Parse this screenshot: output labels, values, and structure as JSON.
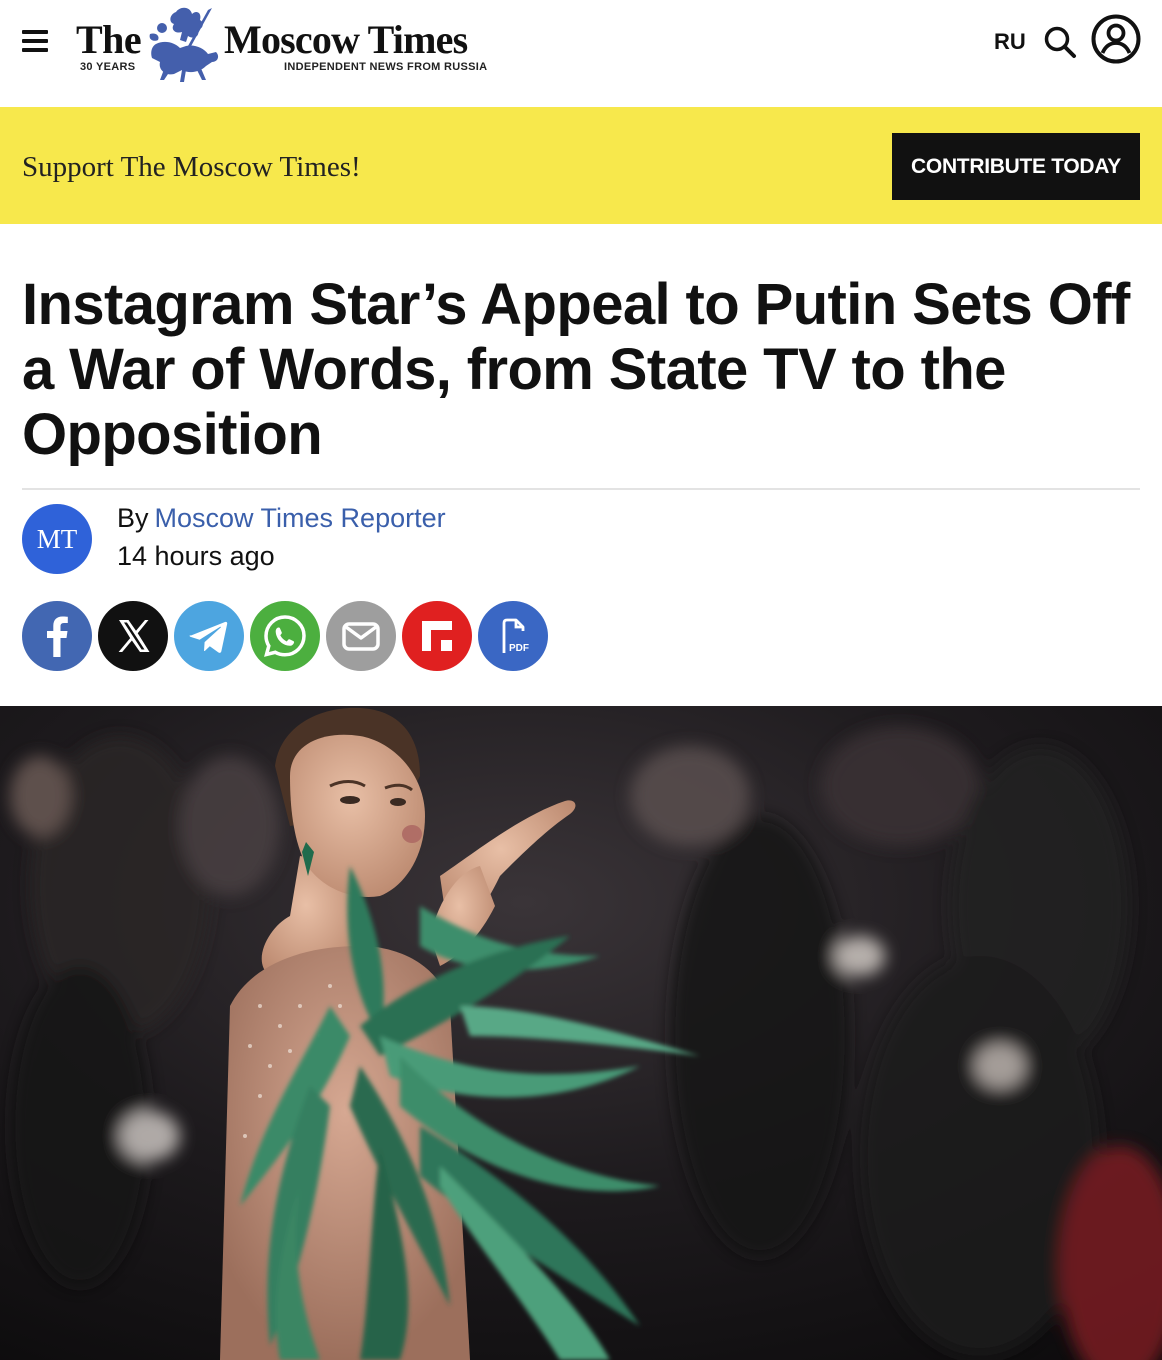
{
  "header": {
    "logo_the": "The",
    "logo_years": "30 YEARS",
    "logo_name": "Moscow Times",
    "logo_tagline": "INDEPENDENT NEWS FROM RUSSIA",
    "lang_label": "RU",
    "icons": {
      "menu": "hamburger-menu-icon",
      "search": "search-icon",
      "account": "user-account-icon"
    }
  },
  "banner": {
    "text": "Support The Moscow Times!",
    "button_label": "CONTRIBUTE TODAY",
    "background": "#f7e84c",
    "button_color": "#111111"
  },
  "article": {
    "headline": "Instagram Star’s Appeal to Putin Sets Off a War of Words, from State TV to the Opposition",
    "avatar_initials": "MT",
    "avatar_color": "#2f62d9",
    "by_label": "By",
    "author": "Moscow Times Reporter",
    "time": "14 hours ago"
  },
  "share": [
    {
      "name": "facebook",
      "icon": "facebook-icon",
      "color": "#4267b2"
    },
    {
      "name": "x",
      "icon": "x-icon",
      "color": "#111111"
    },
    {
      "name": "telegram",
      "icon": "telegram-icon",
      "color": "#4da5e0"
    },
    {
      "name": "whatsapp",
      "icon": "whatsapp-icon",
      "color": "#4caf3f"
    },
    {
      "name": "email",
      "icon": "email-icon",
      "color": "#9e9e9e"
    },
    {
      "name": "flipboard",
      "icon": "flipboard-icon",
      "color": "#e02020"
    },
    {
      "name": "pdf",
      "icon": "pdf-icon",
      "color": "#3a67c4"
    }
  ],
  "hero_image": {
    "description_icon": "photo-icon"
  }
}
